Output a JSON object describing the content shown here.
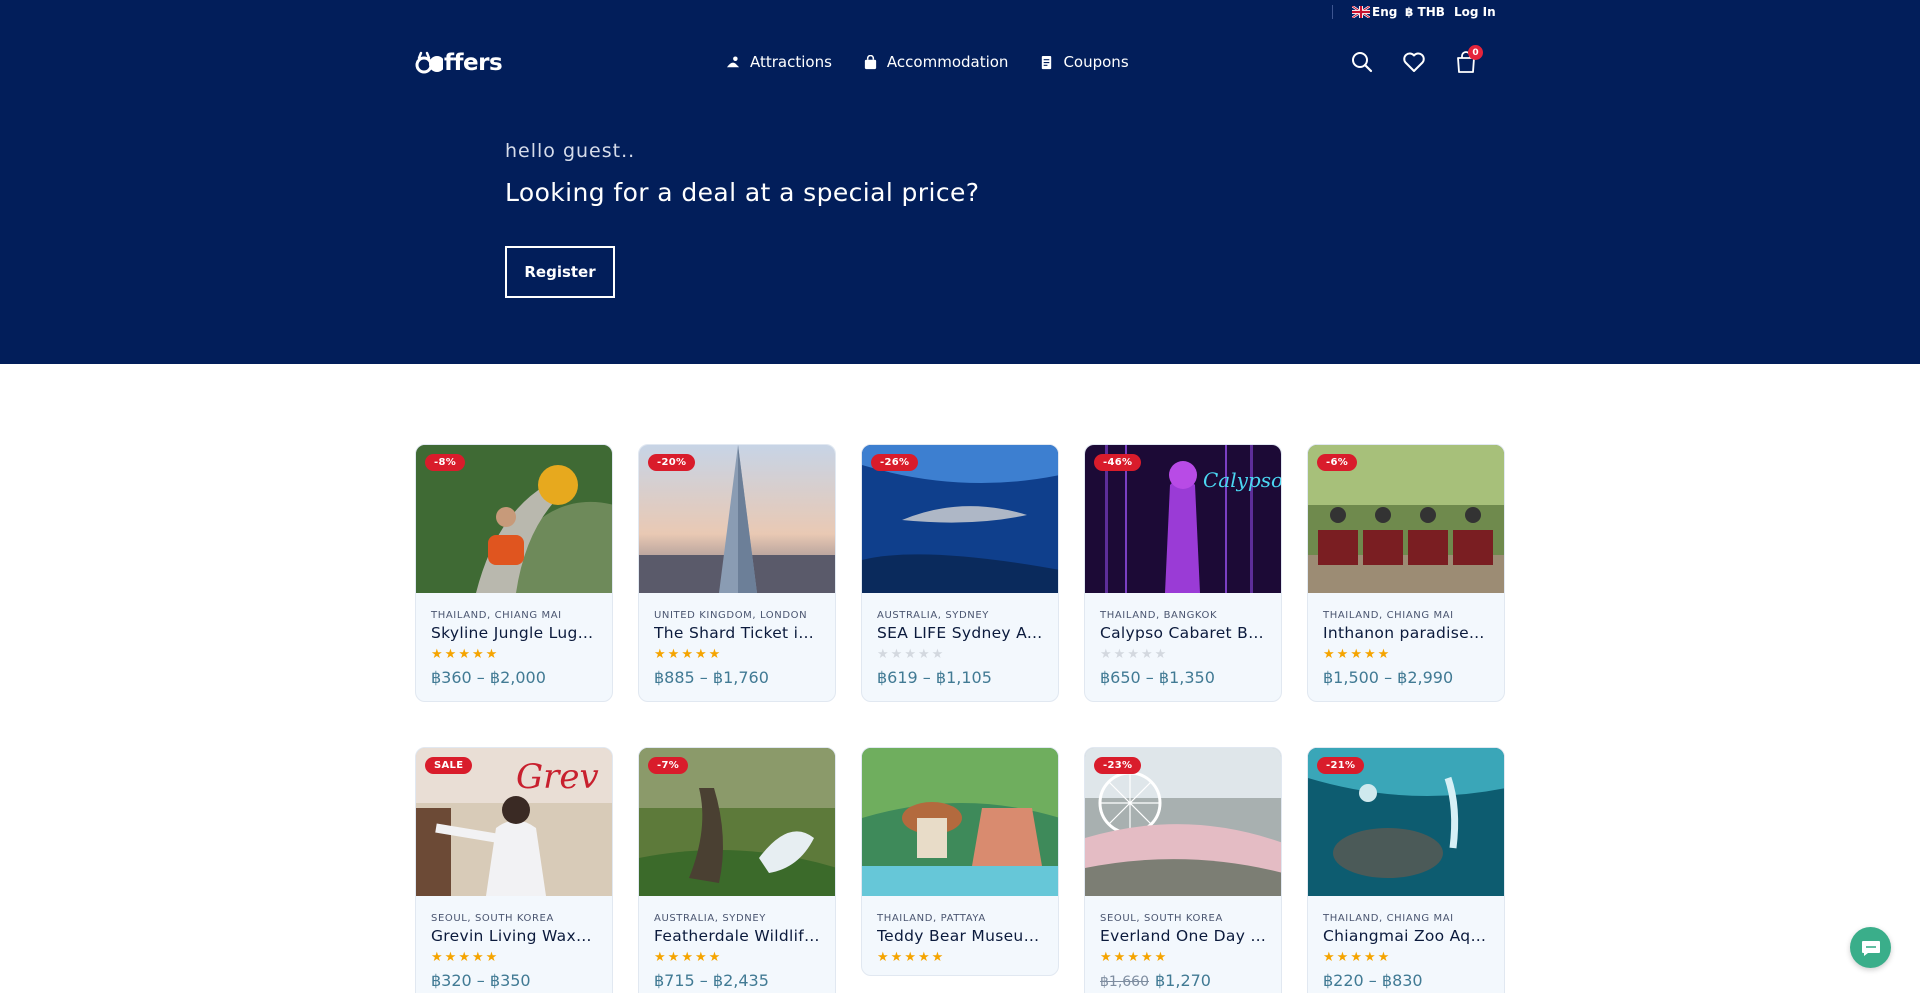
{
  "topbar": {
    "language": "Eng",
    "currency": "฿ THB",
    "login": "Log In"
  },
  "brand": {
    "name": "ffers"
  },
  "nav": [
    {
      "label": "Attractions",
      "icon": "attraction-icon"
    },
    {
      "label": "Accommodation",
      "icon": "bag-icon"
    },
    {
      "label": "Coupons",
      "icon": "coupon-icon"
    }
  ],
  "cart": {
    "count": "0"
  },
  "hero": {
    "greeting": "hello guest..",
    "headline": "Looking for a deal at a special price?",
    "register": "Register"
  },
  "colors": {
    "hero_bg": "#021e5a",
    "badge": "#d91c2b",
    "price": "#417a94",
    "star": "#f5a400",
    "chat": "#3aae8a"
  },
  "products": [
    {
      "badge": "-8%",
      "location": "THAILAND, CHIANG MAI",
      "title": "Skyline Jungle Luge…",
      "rating": 5,
      "price": "฿360 – ฿2,000",
      "old_price": ""
    },
    {
      "badge": "-20%",
      "location": "UNITED KINGDOM, LONDON",
      "title": "The Shard Ticket in…",
      "rating": 5,
      "price": "฿885 – ฿1,760",
      "old_price": ""
    },
    {
      "badge": "-26%",
      "location": "AUSTRALIA, SYDNEY",
      "title": "SEA LIFE Sydney Aq…",
      "rating": 0,
      "price": "฿619 – ฿1,105",
      "old_price": ""
    },
    {
      "badge": "-46%",
      "location": "THAILAND, BANGKOK",
      "title": "Calypso Cabaret Ba…",
      "rating": 0,
      "price": "฿650 – ฿1,350",
      "old_price": ""
    },
    {
      "badge": "-6%",
      "location": "THAILAND, CHIANG MAI",
      "title": "Inthanon paradise A…",
      "rating": 5,
      "price": "฿1,500 – ฿2,990",
      "old_price": ""
    },
    {
      "badge": "SALE",
      "location": "SEOUL, SOUTH KOREA",
      "title": "Grevin Living Waxw…",
      "rating": 5,
      "price": "฿320 – ฿350",
      "old_price": ""
    },
    {
      "badge": "-7%",
      "location": "AUSTRALIA, SYDNEY",
      "title": "Featherdale Wildlife…",
      "rating": 5,
      "price": "฿715 – ฿2,435",
      "old_price": ""
    },
    {
      "badge": "",
      "location": "THAILAND, PATTAYA",
      "title": "Teddy Bear Museum…",
      "rating": 5,
      "price": "",
      "old_price": ""
    },
    {
      "badge": "-23%",
      "location": "SEOUL, SOUTH KOREA",
      "title": "Everland One Day P…",
      "rating": 5,
      "price": "฿1,270",
      "old_price": "฿1,660"
    },
    {
      "badge": "-21%",
      "location": "THAILAND, CHIANG MAI",
      "title": "Chiangmai Zoo Aqu…",
      "rating": 5,
      "price": "฿220 – ฿830",
      "old_price": ""
    }
  ]
}
